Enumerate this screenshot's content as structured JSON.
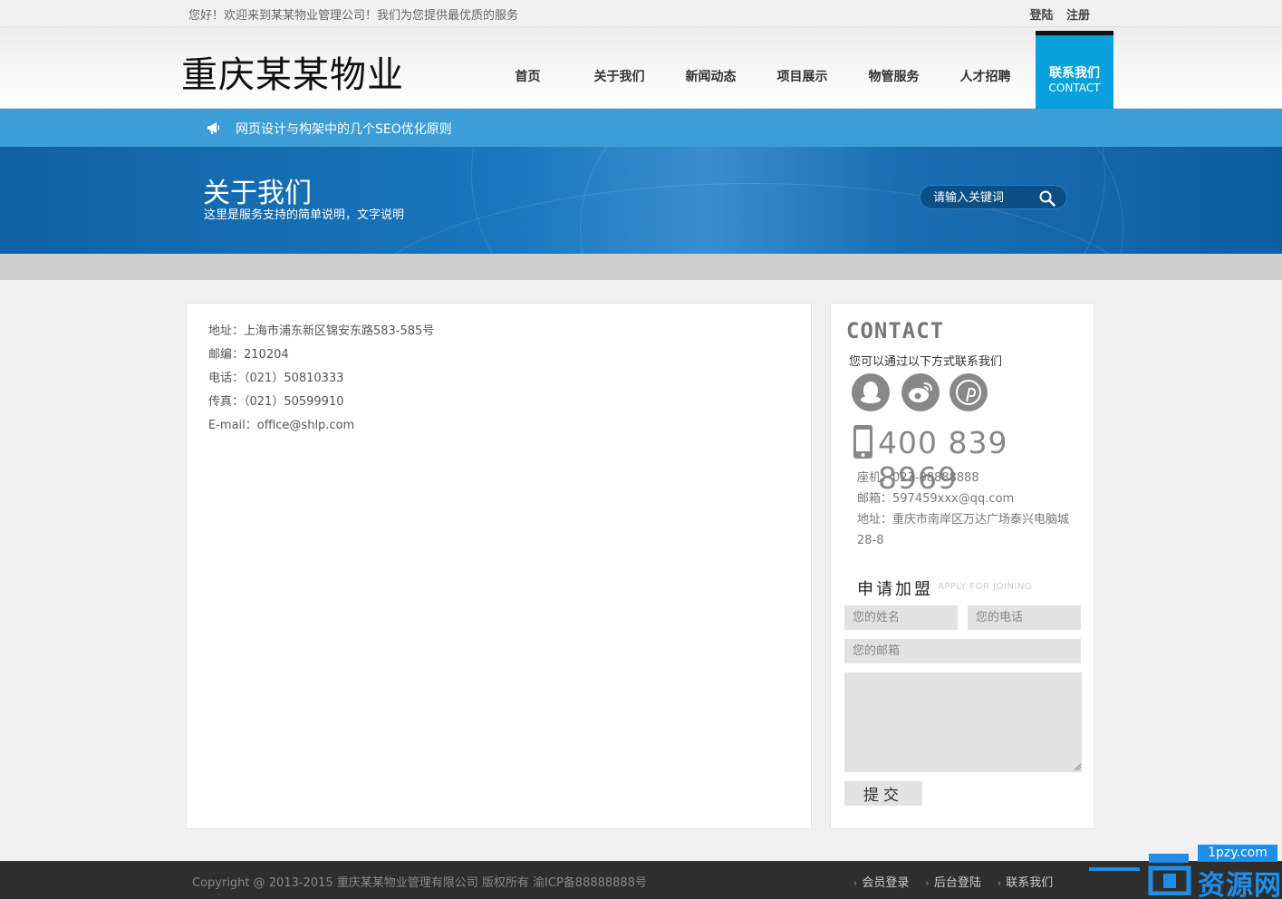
{
  "topbar": {
    "welcome": "您好！欢迎来到某某物业管理公司！我们为您提供最优质的服务",
    "login": "登陆",
    "register": "注册"
  },
  "header": {
    "logo": "重庆某某物业",
    "nav": [
      {
        "label": "首页"
      },
      {
        "label": "关于我们"
      },
      {
        "label": "新闻动态"
      },
      {
        "label": "项目展示"
      },
      {
        "label": "物管服务"
      },
      {
        "label": "人才招聘"
      }
    ],
    "nav_active": {
      "label": "联系我们",
      "sub": "CONTACT"
    }
  },
  "notice": {
    "text": "网页设计与构架中的几个SEO优化原则",
    "icon": "megaphone-icon"
  },
  "banner": {
    "title": "关于我们",
    "subtitle": "这里是服务支持的简单说明，文字说明",
    "search_placeholder": "请输入关键词"
  },
  "content": {
    "lines": [
      "地址：上海市浦东新区锦安东路583-585号",
      "邮编：210204",
      "电话：（021）50810333",
      "传真：（021）50599910",
      "E-mail：office@shlp.com"
    ]
  },
  "sidebar": {
    "title": "CONTACT",
    "subtitle": "您可以通过以下方式联系我们",
    "social": [
      "qq-icon",
      "weibo-icon",
      "pinterest-icon"
    ],
    "phone": "400 839 8969",
    "landline": "座机：023-88888888",
    "email": "邮箱：597459xxx@qq.com",
    "address": "地址：重庆市南岸区万达广场泰兴电脑城28-8",
    "join_title": "申请加盟",
    "join_sub": "APPLY FOR JOINING",
    "name_placeholder": "您的姓名",
    "phone_placeholder": "您的电话",
    "email_placeholder": "您的邮箱",
    "submit": "提交"
  },
  "footer": {
    "copyright": "Copyright @ 2013-2015 重庆某某物业管理有限公司 版权所有 渝ICP备88888888号",
    "links": [
      "会员登录",
      "后台登陆",
      "联系我们"
    ]
  },
  "watermark": {
    "domain": "1pzy.com",
    "text": "资源网"
  },
  "colors": {
    "accent": "#0aa0dd",
    "notice": "#3d9ed7",
    "banner": "#1161a4",
    "footer": "#2e2e2e"
  }
}
